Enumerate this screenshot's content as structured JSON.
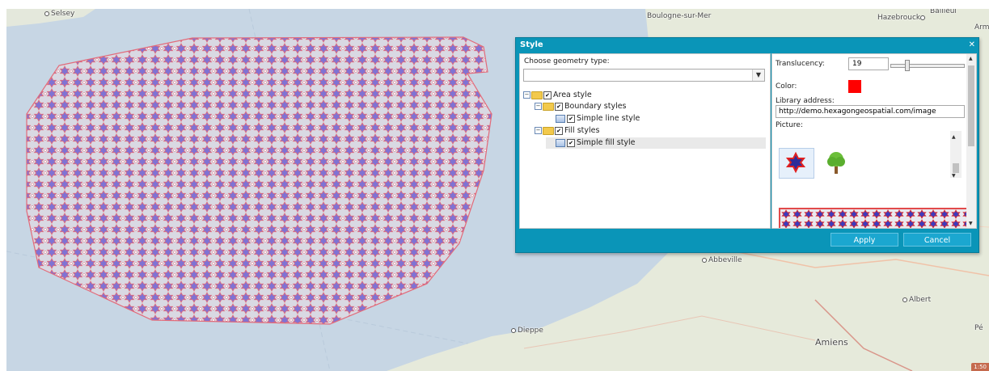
{
  "map": {
    "places": [
      {
        "name": "Selsey"
      },
      {
        "name": "Boulogne-sur-Mer"
      },
      {
        "name": "Hazebrouck"
      },
      {
        "name": "Bailleul"
      },
      {
        "name": "Armen"
      },
      {
        "name": "Abbeville"
      },
      {
        "name": "Dieppe"
      },
      {
        "name": "Albert"
      },
      {
        "name": "Amiens"
      },
      {
        "name": "Pé"
      }
    ],
    "scale_badge": "1:50",
    "colors": {
      "sea": "#c7d7e6",
      "land": "#e6eadb",
      "polygon_fill": "#dcdce6",
      "polygon_stroke": "#e26b7a",
      "star": "#7b6fd0"
    }
  },
  "dialog": {
    "title": "Style",
    "close_icon": "close-icon",
    "geometry_label": "Choose geometry type:",
    "geometry_value": "",
    "tree": [
      {
        "label": "Area style",
        "level": 0,
        "checked": true
      },
      {
        "label": "Boundary styles",
        "level": 1,
        "checked": true
      },
      {
        "label": "Simple line style",
        "level": 2,
        "checked": true
      },
      {
        "label": "Fill styles",
        "level": 1,
        "checked": true
      },
      {
        "label": "Simple fill style",
        "level": 2,
        "checked": true,
        "selected": true
      }
    ],
    "translucency_label": "Translucency:",
    "translucency_value": "19",
    "color_label": "Color:",
    "color_value": "#ff0000",
    "library_label": "Library address:",
    "library_value": "http://demo.hexagongeospatial.com/image",
    "picture_label": "Picture:",
    "pictures": [
      {
        "icon": "star-pattern-icon"
      },
      {
        "icon": "tree-icon"
      }
    ],
    "apply_label": "Apply",
    "cancel_label": "Cancel"
  }
}
